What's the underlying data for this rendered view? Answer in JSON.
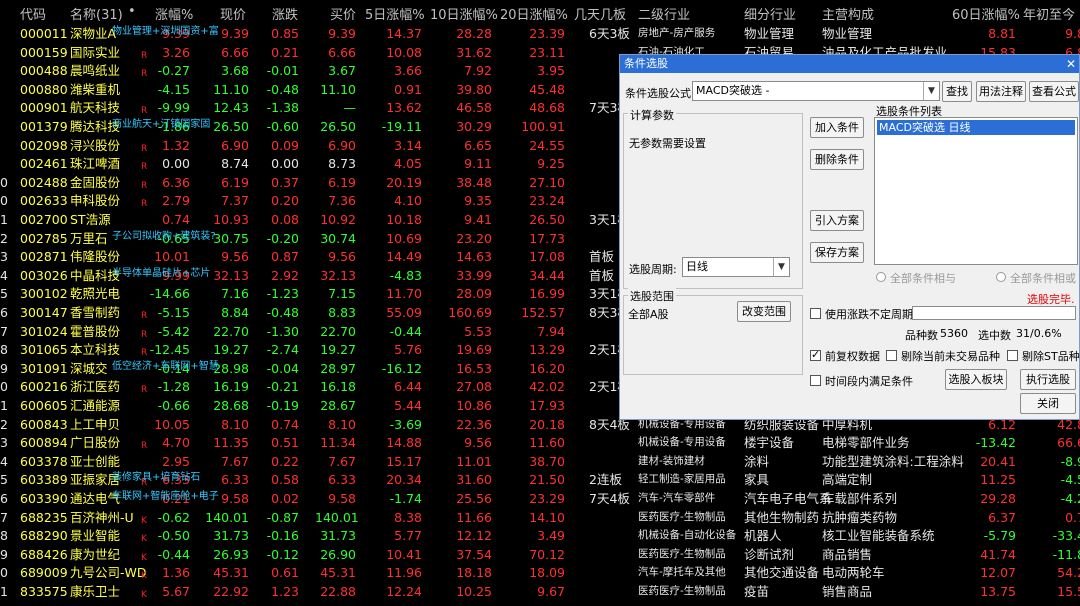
{
  "header": {
    "code": "代码",
    "name": "名称(31)",
    "dot": "•",
    "chg": "涨幅%",
    "price": "现价",
    "change": "涨跌",
    "bid": "买价",
    "d5": "5日涨幅%",
    "d10": "10日涨幅%",
    "d20": "20日涨幅%",
    "days": "几天几板",
    "ind1": "二级行业",
    "ind2": "细分行业",
    "main": "主营构成",
    "d60": "60日涨幅%",
    "ytd": "年初至今"
  },
  "rows": [
    {
      "no": "",
      "code": "000011",
      "name": "深物业A",
      "flag": "",
      "ann": "物业管理+深圳国资+富",
      "chg": "9.39",
      "price": "9.39",
      "change": "0.85",
      "bid": "9.39",
      "d5": "14.37",
      "d10": "28.28",
      "d20": "23.39",
      "days": "6天3板",
      "ind1": "房地产-房产服务",
      "ind2": "物业管理",
      "main": "物业管理",
      "d60": "8.81",
      "ytd": "9.8"
    },
    {
      "no": "",
      "code": "000159",
      "name": "国际实业",
      "flag": "R",
      "ann": "",
      "chg": "3.26",
      "price": "6.66",
      "change": "0.21",
      "bid": "6.66",
      "d5": "10.08",
      "d10": "31.62",
      "d20": "23.11",
      "days": "",
      "ind1": "石油-石油化工",
      "ind2": "石油贸易",
      "main": "油品及化工产品批发业",
      "d60": "15.83",
      "ytd": "6.8"
    },
    {
      "no": "",
      "code": "000488",
      "name": "晨鸣纸业",
      "flag": "R",
      "ann": "",
      "chg": "-0.27",
      "price": "3.68",
      "change": "-0.01",
      "bid": "3.67",
      "d5": "3.66",
      "d10": "7.92",
      "d20": "3.95",
      "days": "",
      "ind1": "",
      "ind2": "",
      "main": "",
      "d60": "",
      "ytd": ""
    },
    {
      "no": "",
      "code": "000880",
      "name": "潍柴重机",
      "flag": "",
      "ann": "",
      "chg": "-4.15",
      "price": "11.10",
      "change": "-0.48",
      "bid": "11.10",
      "d5": "0.91",
      "d10": "39.80",
      "d20": "45.48",
      "days": "",
      "ind1": "",
      "ind2": "",
      "main": "",
      "d60": "",
      "ytd": ""
    },
    {
      "no": "",
      "code": "000901",
      "name": "航天科技",
      "flag": "R",
      "ann": "",
      "chg": "-9.99",
      "price": "12.43",
      "change": "-1.38",
      "bid": "—",
      "d5": "13.62",
      "d10": "46.58",
      "d20": "48.68",
      "days": "7天3板",
      "ind1": "",
      "ind2": "",
      "main": "",
      "d60": "",
      "ytd": ""
    },
    {
      "no": "",
      "code": "001379",
      "name": "腾达科技",
      "flag": "",
      "ann": "商业航天+汀镇国家固",
      "chg": "-1.86",
      "price": "26.50",
      "change": "-0.60",
      "bid": "26.50",
      "d5": "-19.11",
      "d10": "30.29",
      "d20": "100.91",
      "days": "",
      "ind1": "",
      "ind2": "",
      "main": "",
      "d60": "",
      "ytd": ""
    },
    {
      "no": "",
      "code": "002098",
      "name": "浔兴股份",
      "flag": "R",
      "ann": "",
      "chg": "1.32",
      "price": "6.90",
      "change": "0.09",
      "bid": "6.90",
      "d5": "3.14",
      "d10": "6.65",
      "d20": "24.55",
      "days": "",
      "ind1": "",
      "ind2": "",
      "main": "",
      "d60": "",
      "ytd": ""
    },
    {
      "no": "",
      "code": "002461",
      "name": "珠江啤酒",
      "flag": "R",
      "ann": "",
      "chg": "0.00",
      "price": "8.74",
      "change": "0.00",
      "bid": "8.73",
      "d5": "4.05",
      "d10": "9.11",
      "d20": "9.25",
      "days": "",
      "ind1": "",
      "ind2": "",
      "main": "",
      "d60": "",
      "ytd": ""
    },
    {
      "no": "0",
      "code": "002488",
      "name": "金固股份",
      "flag": "R",
      "ann": "",
      "chg": "6.36",
      "price": "6.19",
      "change": "0.37",
      "bid": "6.19",
      "d5": "20.19",
      "d10": "38.48",
      "d20": "27.10",
      "days": "",
      "ind1": "",
      "ind2": "",
      "main": "",
      "d60": "",
      "ytd": ""
    },
    {
      "no": "0",
      "code": "002633",
      "name": "申科股份",
      "flag": "R",
      "ann": "",
      "chg": "2.79",
      "price": "7.37",
      "change": "0.20",
      "bid": "7.36",
      "d5": "4.10",
      "d10": "9.35",
      "d20": "23.24",
      "days": "",
      "ind1": "",
      "ind2": "",
      "main": "",
      "d60": "",
      "ytd": ""
    },
    {
      "no": "1",
      "code": "002700",
      "name": "ST浩源",
      "flag": "",
      "ann": "",
      "chg": "0.74",
      "price": "10.93",
      "change": "0.08",
      "bid": "10.92",
      "d5": "10.18",
      "d10": "9.41",
      "d20": "26.50",
      "days": "3天1板",
      "ind1": "",
      "ind2": "",
      "main": "",
      "d60": "",
      "ytd": ""
    },
    {
      "no": "2",
      "code": "002785",
      "name": "万里石",
      "flag": "",
      "ann": "子公司拟收购+建筑装?",
      "chg": "-0.65",
      "price": "30.75",
      "change": "-0.20",
      "bid": "30.74",
      "d5": "10.69",
      "d10": "23.20",
      "d20": "17.73",
      "days": "",
      "ind1": "",
      "ind2": "",
      "main": "",
      "d60": "",
      "ytd": ""
    },
    {
      "no": "3",
      "code": "002871",
      "name": "伟隆股份",
      "flag": "",
      "ann": "",
      "chg": "10.01",
      "price": "9.56",
      "change": "0.87",
      "bid": "9.56",
      "d5": "14.49",
      "d10": "14.63",
      "d20": "17.08",
      "days": "首板",
      "ind1": "",
      "ind2": "",
      "main": "",
      "d60": "",
      "ytd": ""
    },
    {
      "no": "4",
      "code": "003026",
      "name": "中晶科技",
      "flag": "",
      "ann": "半导体单晶硅片+芯片",
      "chg": "9.99",
      "price": "32.13",
      "change": "2.92",
      "bid": "32.13",
      "d5": "-4.83",
      "d10": "33.99",
      "d20": "34.44",
      "days": "首板",
      "ind1": "",
      "ind2": "",
      "main": "",
      "d60": "",
      "ytd": ""
    },
    {
      "no": "5",
      "code": "300102",
      "name": "乾照光电",
      "flag": "",
      "ann": "",
      "chg": "-14.66",
      "price": "7.16",
      "change": "-1.23",
      "bid": "7.15",
      "d5": "11.70",
      "d10": "28.09",
      "d20": "16.99",
      "days": "3天1板",
      "ind1": "",
      "ind2": "",
      "main": "",
      "d60": "",
      "ytd": ""
    },
    {
      "no": "6",
      "code": "300147",
      "name": "香雪制药",
      "flag": "R",
      "ann": "",
      "chg": "-5.15",
      "price": "8.84",
      "change": "-0.48",
      "bid": "8.83",
      "d5": "55.09",
      "d10": "160.69",
      "d20": "152.57",
      "days": "8天3板",
      "ind1": "",
      "ind2": "",
      "main": "",
      "d60": "",
      "ytd": ""
    },
    {
      "no": "7",
      "code": "301024",
      "name": "霍普股份",
      "flag": "R",
      "ann": "",
      "chg": "-5.42",
      "price": "22.70",
      "change": "-1.30",
      "bid": "22.70",
      "d5": "-0.44",
      "d10": "5.53",
      "d20": "7.94",
      "days": "",
      "ind1": "",
      "ind2": "",
      "main": "",
      "d60": "",
      "ytd": ""
    },
    {
      "no": "8",
      "code": "301065",
      "name": "本立科技",
      "flag": "R",
      "ann": "",
      "chg": "-12.45",
      "price": "19.27",
      "change": "-2.74",
      "bid": "19.27",
      "d5": "5.76",
      "d10": "19.69",
      "d20": "13.29",
      "days": "2天1板",
      "ind1": "",
      "ind2": "",
      "main": "",
      "d60": "",
      "ytd": ""
    },
    {
      "no": "9",
      "code": "301091",
      "name": "深城交",
      "flag": "",
      "ann": "低空经济+车联网+智慧",
      "chg": "-0.14",
      "price": "28.98",
      "change": "-0.04",
      "bid": "28.97",
      "d5": "-16.12",
      "d10": "16.53",
      "d20": "16.20",
      "days": "",
      "ind1": "",
      "ind2": "",
      "main": "",
      "d60": "",
      "ytd": ""
    },
    {
      "no": "0",
      "code": "600216",
      "name": "浙江医药",
      "flag": "R",
      "ann": "",
      "chg": "-1.28",
      "price": "16.19",
      "change": "-0.21",
      "bid": "16.18",
      "d5": "6.44",
      "d10": "27.08",
      "d20": "42.02",
      "days": "2天1板",
      "ind1": "",
      "ind2": "",
      "main": "",
      "d60": "",
      "ytd": ""
    },
    {
      "no": "1",
      "code": "600605",
      "name": "汇通能源",
      "flag": "",
      "ann": "",
      "chg": "-0.66",
      "price": "28.68",
      "change": "-0.19",
      "bid": "28.67",
      "d5": "5.44",
      "d10": "10.86",
      "d20": "17.93",
      "days": "",
      "ind1": "",
      "ind2": "",
      "main": "",
      "d60": "",
      "ytd": ""
    },
    {
      "no": "2",
      "code": "600843",
      "name": "上工申贝",
      "flag": "",
      "ann": "",
      "chg": "10.05",
      "price": "8.10",
      "change": "0.74",
      "bid": "8.10",
      "d5": "-3.69",
      "d10": "22.36",
      "d20": "20.18",
      "days": "8天4板",
      "ind1": "机械设备-专用设备",
      "ind2": "纺织服装设备",
      "main": "中厚料机",
      "d60": "6.12",
      "ytd": "42.8"
    },
    {
      "no": "3",
      "code": "600894",
      "name": "广日股份",
      "flag": "R",
      "ann": "",
      "chg": "4.70",
      "price": "11.35",
      "change": "0.51",
      "bid": "11.34",
      "d5": "14.88",
      "d10": "9.56",
      "d20": "11.60",
      "days": "",
      "ind1": "机械设备-专用设备",
      "ind2": "楼宇设备",
      "main": "电梯零部件业务",
      "d60": "-13.42",
      "ytd": "66.6"
    },
    {
      "no": "4",
      "code": "603378",
      "name": "亚士创能",
      "flag": "",
      "ann": "",
      "chg": "2.95",
      "price": "7.67",
      "change": "0.22",
      "bid": "7.67",
      "d5": "15.17",
      "d10": "11.01",
      "d20": "38.70",
      "days": "",
      "ind1": "建材-装饰建材",
      "ind2": "涂料",
      "main": "功能型建筑涂料:工程涂料",
      "d60": "20.41",
      "ytd": "-8.9"
    },
    {
      "no": "5",
      "code": "603389",
      "name": "亚振家居",
      "flag": "R",
      "ann": "装修家具+培育钻石",
      "chg": "6.33",
      "price": "6.33",
      "change": "0.58",
      "bid": "6.33",
      "d5": "20.34",
      "d10": "31.60",
      "d20": "21.50",
      "days": "2连板",
      "ind1": "轻工制造-家居用品",
      "ind2": "家具",
      "main": "高端定制",
      "d60": "11.25",
      "ytd": "-4.5"
    },
    {
      "no": "6",
      "code": "603390",
      "name": "通达电气",
      "flag": "",
      "ann": "车联网+智能座舱+电子",
      "chg": "0.21",
      "price": "9.58",
      "change": "0.02",
      "bid": "9.58",
      "d5": "-1.74",
      "d10": "25.56",
      "d20": "23.29",
      "days": "7天4板",
      "ind1": "汽车-汽车零部件",
      "ind2": "汽车电子电气系",
      "main": "车载部件系列",
      "d60": "29.28",
      "ytd": "-4.2"
    },
    {
      "no": "7",
      "code": "688235",
      "name": "百济神州-U",
      "flag": "K",
      "ann": "",
      "chg": "-0.62",
      "price": "140.01",
      "change": "-0.87",
      "bid": "140.01",
      "d5": "8.38",
      "d10": "11.66",
      "d20": "14.10",
      "days": "",
      "ind1": "医药医疗-生物制品",
      "ind2": "其他生物制药",
      "main": "抗肿瘤类药物",
      "d60": "6.37",
      "ytd": "0.7"
    },
    {
      "no": "8",
      "code": "688290",
      "name": "景业智能",
      "flag": "K",
      "ann": "",
      "chg": "-0.50",
      "price": "31.73",
      "change": "-0.16",
      "bid": "31.73",
      "d5": "5.77",
      "d10": "12.12",
      "d20": "3.49",
      "days": "",
      "ind1": "机械设备-自动化设备",
      "ind2": "机器人",
      "main": "核工业智能装备系统",
      "d60": "-5.79",
      "ytd": "-33.4"
    },
    {
      "no": "9",
      "code": "688426",
      "name": "康为世纪",
      "flag": "K",
      "ann": "",
      "chg": "-0.44",
      "price": "26.93",
      "change": "-0.12",
      "bid": "26.90",
      "d5": "10.41",
      "d10": "37.54",
      "d20": "70.12",
      "days": "",
      "ind1": "医药医疗-生物制品",
      "ind2": "诊断试剂",
      "main": "商品销售",
      "d60": "41.74",
      "ytd": "-11.8"
    },
    {
      "no": "0",
      "code": "689009",
      "name": "九号公司-WD",
      "flag": "K",
      "ann": "",
      "chg": "1.36",
      "price": "45.31",
      "change": "0.61",
      "bid": "45.31",
      "d5": "11.96",
      "d10": "18.18",
      "d20": "18.09",
      "days": "",
      "ind1": "汽车-摩托车及其他",
      "ind2": "其他交通设备",
      "main": "电动两轮车",
      "d60": "12.07",
      "ytd": "54.2"
    },
    {
      "no": "1",
      "code": "833575",
      "name": "康乐卫士",
      "flag": "K",
      "ann": "",
      "chg": "5.67",
      "price": "22.92",
      "change": "1.23",
      "bid": "22.88",
      "d5": "12.24",
      "d10": "10.25",
      "d20": "9.67",
      "days": "",
      "ind1": "医药医疗-生物制品",
      "ind2": "疫苗",
      "main": "销售商品",
      "d60": "13.75",
      "ytd": "15.5"
    }
  ],
  "dialog": {
    "title": "条件选股",
    "close": "✕",
    "formula_label": "条件选股公式",
    "formula_value": "MACD突破选  -",
    "find_btn": "查找",
    "usage_btn": "用法注释",
    "view_btn": "查看公式",
    "params_group": "计算参数",
    "no_params": "无参数需要设置",
    "add_btn": "加入条件",
    "del_btn": "删除条件",
    "list_group": "选股条件列表",
    "list_item": "MACD突破选  日线",
    "import_btn": "引入方案",
    "save_btn": "保存方案",
    "period_label": "选股周期:",
    "period_value": "日线",
    "radio_and": "全部条件相与",
    "radio_or": "全部条件相或",
    "done": "选股完毕.",
    "range_group": "选股范围",
    "range_value": "全部A股",
    "change_range_btn": "改变范围",
    "uncertain_label": "使用涨跌不定周期",
    "count_label": "品种数",
    "count_value": "5360",
    "hit_label": "选中数",
    "hit_value": "31/0.6%",
    "pre_adjust": "前复权数据",
    "exclude_suspend": "剔除当前未交易品种",
    "exclude_st": "剔除ST品种",
    "time_range": "时间段内满足条件",
    "to_block_btn": "选股入板块",
    "exec_btn": "执行选股",
    "close_btn": "关闭"
  },
  "colors": {
    "up": "#ff3030",
    "down": "#30ff30",
    "code": "#ffff44",
    "accent": "#2b6fd6"
  }
}
